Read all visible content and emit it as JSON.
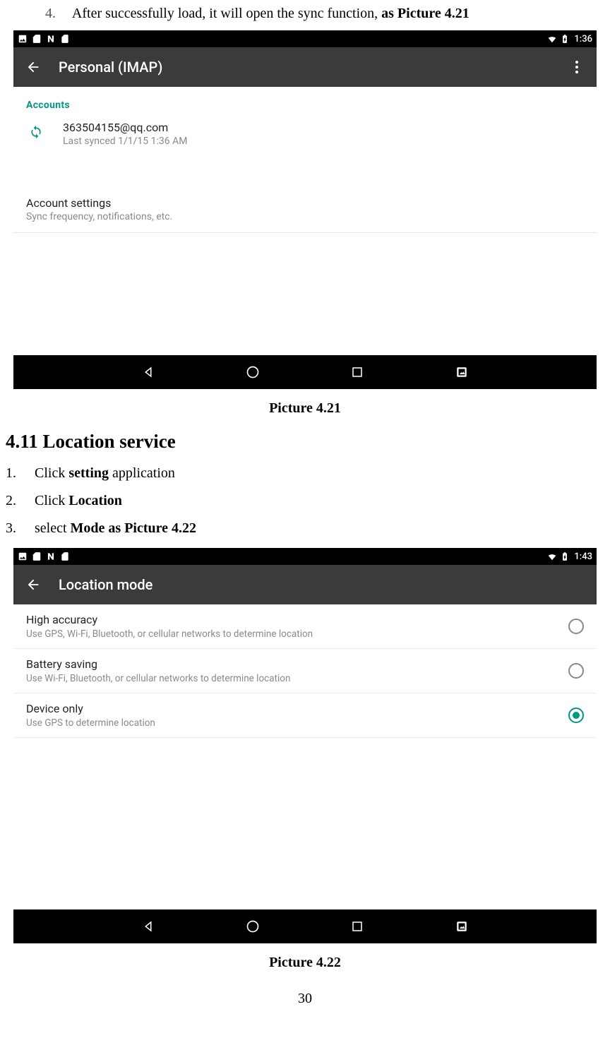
{
  "doc": {
    "line4_num": "4.",
    "line4_pre": "After successfully load, it will open the sync function, ",
    "line4_bold": "as Picture 4.21",
    "caption1": "Picture 4.21",
    "section": "4.11 Location service",
    "step1_num": "1.",
    "step1_pre": "Click ",
    "step1_bold": "setting",
    "step1_post": " application",
    "step2_num": "2.",
    "step2_pre": "Click ",
    "step2_bold": "Location",
    "step3_num": "3.",
    "step3_pre": "select ",
    "step3_bold": "Mode as Picture 4.22",
    "caption2": "Picture 4.22",
    "page_number": "30"
  },
  "ss1": {
    "clock": "1:36",
    "title": "Personal (IMAP)",
    "sub_header": "Accounts",
    "account_email": "363504155@qq.com",
    "account_sync": "Last synced 1/1/15 1:36 AM",
    "settings_title": "Account settings",
    "settings_sub": "Sync frequency, notifications, etc."
  },
  "ss2": {
    "clock": "1:43",
    "title": "Location mode",
    "options": {
      "0": {
        "title": "High accuracy",
        "sub": "Use GPS, Wi-Fi, Bluetooth, or cellular networks to determine location"
      },
      "1": {
        "title": "Battery saving",
        "sub": "Use Wi-Fi, Bluetooth, or cellular networks to determine location"
      },
      "2": {
        "title": "Device only",
        "sub": "Use GPS to determine location"
      }
    }
  }
}
